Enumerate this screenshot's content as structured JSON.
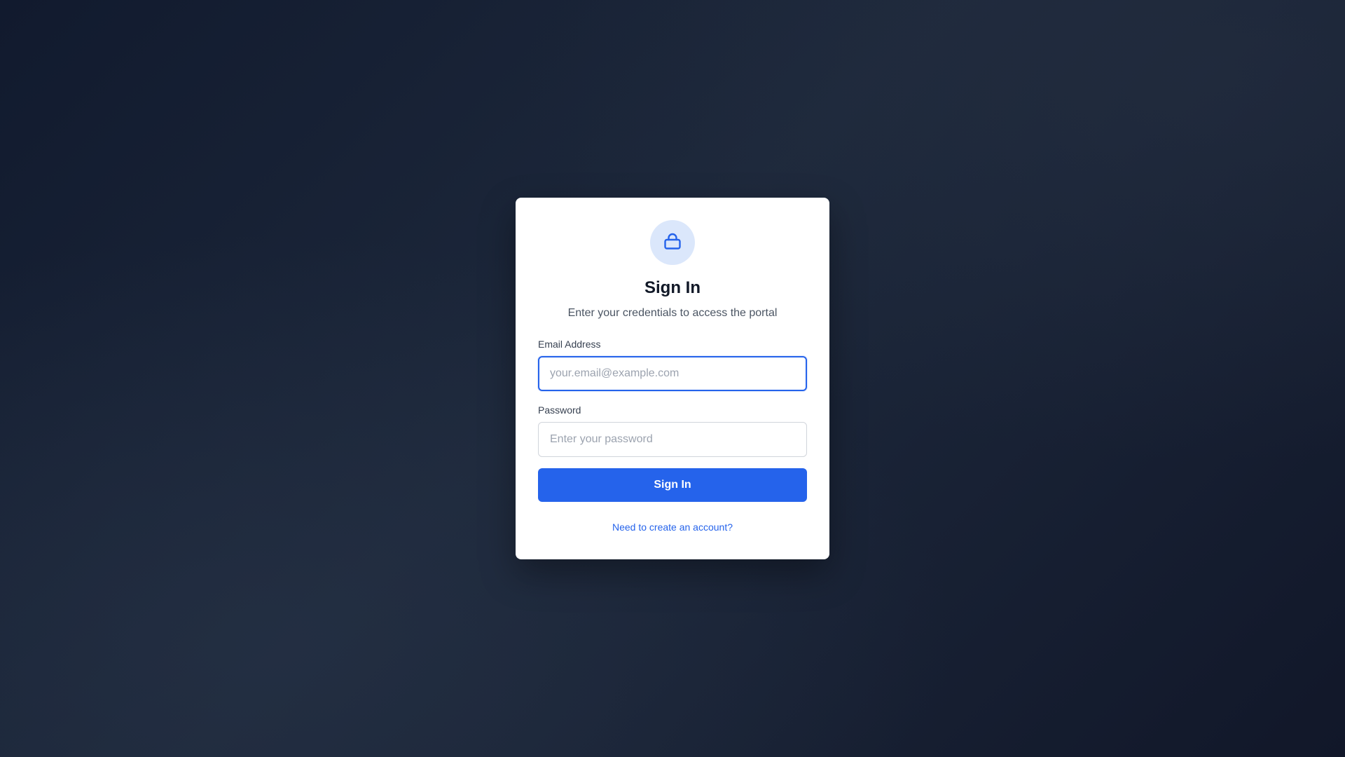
{
  "colors": {
    "accent": "#2563eb",
    "icon_bg": "#dbe7fb",
    "card_bg": "#ffffff",
    "page_bg": "#1a2437"
  },
  "login": {
    "icon": "lock-icon",
    "title": "Sign In",
    "subtitle": "Enter your credentials to access the portal",
    "email": {
      "label": "Email Address",
      "value": "",
      "placeholder": "your.email@example.com"
    },
    "password": {
      "label": "Password",
      "value": "",
      "placeholder": "Enter your password"
    },
    "submit_label": "Sign In",
    "create_account_link": "Need to create an account?"
  }
}
